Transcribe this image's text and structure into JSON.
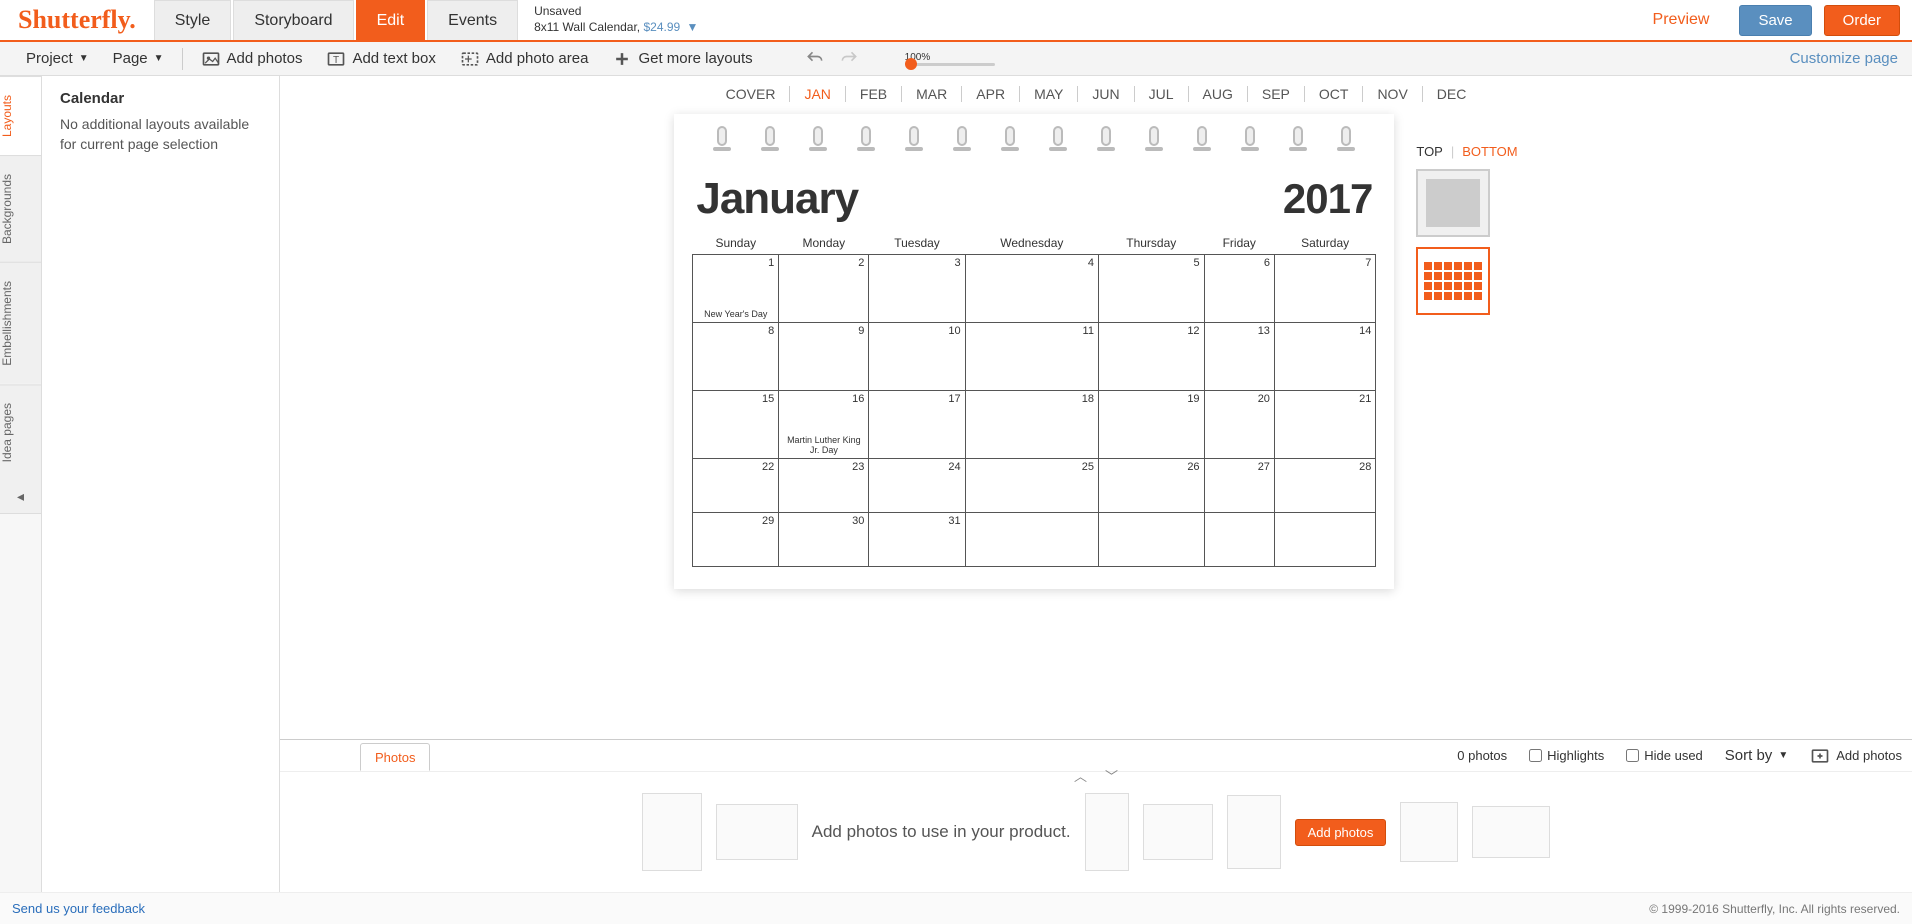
{
  "header": {
    "logo": "Shutterfly.",
    "tabs": [
      "Style",
      "Storyboard",
      "Edit",
      "Events"
    ],
    "activeTab": "Edit",
    "statusLine1": "Unsaved",
    "statusLine2Product": "8x11 Wall Calendar,",
    "statusLine2Price": "$24.99",
    "preview": "Preview",
    "save": "Save",
    "order": "Order"
  },
  "toolbar": {
    "project": "Project",
    "page": "Page",
    "addPhotos": "Add photos",
    "addTextBox": "Add text box",
    "addPhotoArea": "Add photo area",
    "getMoreLayouts": "Get more layouts",
    "zoomLabel": "100%",
    "customize": "Customize page"
  },
  "sidebar": {
    "tabs": [
      "Layouts",
      "Backgrounds",
      "Embellishments",
      "Idea pages"
    ],
    "activeTab": "Layouts",
    "title": "Calendar",
    "message": "No additional layouts available for current page selection"
  },
  "months": {
    "items": [
      "COVER",
      "JAN",
      "FEB",
      "MAR",
      "APR",
      "MAY",
      "JUN",
      "JUL",
      "AUG",
      "SEP",
      "OCT",
      "NOV",
      "DEC"
    ],
    "active": "JAN"
  },
  "calendar": {
    "month": "January",
    "year": "2017",
    "weekdays": [
      "Sunday",
      "Monday",
      "Tuesday",
      "Wednesday",
      "Thursday",
      "Friday",
      "Saturday"
    ],
    "weeks": [
      [
        {
          "d": "1",
          "e": "New Year's Day"
        },
        {
          "d": "2"
        },
        {
          "d": "3"
        },
        {
          "d": "4"
        },
        {
          "d": "5"
        },
        {
          "d": "6"
        },
        {
          "d": "7"
        }
      ],
      [
        {
          "d": "8"
        },
        {
          "d": "9"
        },
        {
          "d": "10"
        },
        {
          "d": "11"
        },
        {
          "d": "12"
        },
        {
          "d": "13"
        },
        {
          "d": "14"
        }
      ],
      [
        {
          "d": "15"
        },
        {
          "d": "16",
          "e": "Martin Luther King Jr. Day"
        },
        {
          "d": "17"
        },
        {
          "d": "18"
        },
        {
          "d": "19"
        },
        {
          "d": "20"
        },
        {
          "d": "21"
        }
      ],
      [
        {
          "d": "22"
        },
        {
          "d": "23"
        },
        {
          "d": "24"
        },
        {
          "d": "25"
        },
        {
          "d": "26"
        },
        {
          "d": "27"
        },
        {
          "d": "28"
        }
      ],
      [
        {
          "d": "29"
        },
        {
          "d": "30"
        },
        {
          "d": "31"
        },
        {
          "d": ""
        },
        {
          "d": ""
        },
        {
          "d": ""
        },
        {
          "d": ""
        }
      ]
    ]
  },
  "viewToggle": {
    "top": "TOP",
    "bottom": "BOTTOM",
    "active": "BOTTOM"
  },
  "photos": {
    "tab": "Photos",
    "count": "0 photos",
    "highlights": "Highlights",
    "hideUsed": "Hide used",
    "sortBy": "Sort by",
    "addPhotos": "Add photos",
    "stripText": "Add photos to use in your product.",
    "stripBtn": "Add photos"
  },
  "footer": {
    "feedback": "Send us your feedback",
    "copyright": "© 1999-2016 Shutterfly, Inc. All rights reserved."
  }
}
